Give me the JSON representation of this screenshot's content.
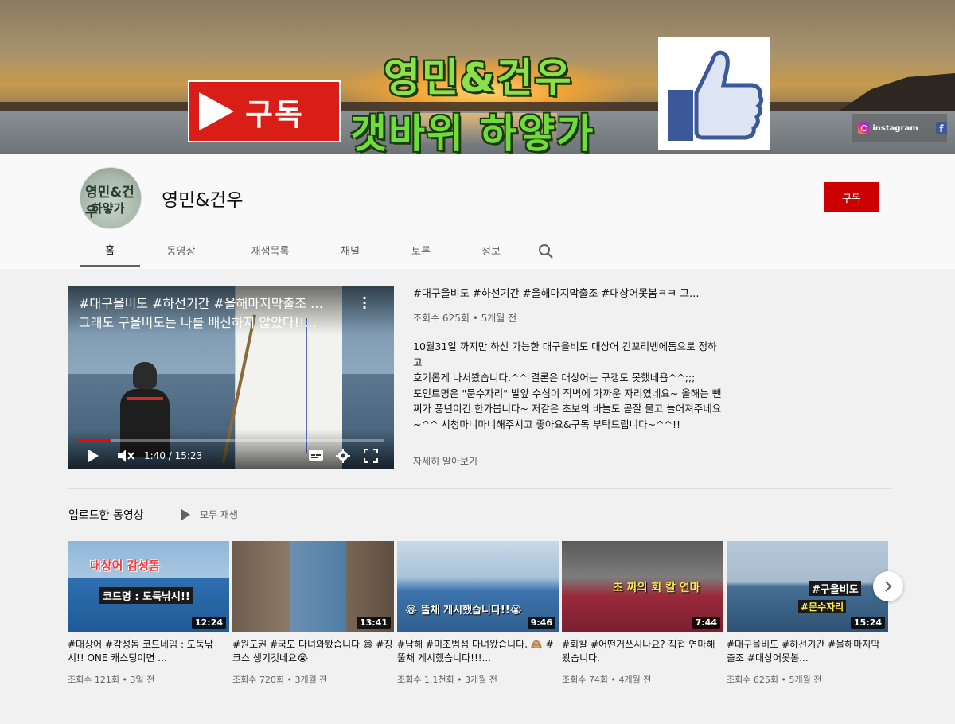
{
  "banner": {
    "subscribe_text": "구독",
    "title": "영민&건우",
    "subtitle": "갯바위 하얗가",
    "social": {
      "instagram_label": "instagram",
      "facebook_glyph": "f"
    }
  },
  "channel": {
    "name": "영민&건우",
    "avatar_text_1": "영민&건우",
    "avatar_text_2": "하얗가",
    "subscribe_label": "구독"
  },
  "tabs": [
    {
      "label": "홈",
      "active": true
    },
    {
      "label": "동영상"
    },
    {
      "label": "재생목록"
    },
    {
      "label": "채널"
    },
    {
      "label": "토론"
    },
    {
      "label": "정보"
    }
  ],
  "featured": {
    "player_title_line1": "#대구을비도 #하선기간 #올해마지막출조 …",
    "player_title_line2": "그래도 구을비도는 나를 배신하지 않았다!!...",
    "current_time": "1:40 / 15:23",
    "progress": 0.108,
    "title": "#대구을비도 #하선기간 #올해마지막출조 #대상어못봄ㅋㅋ 그...",
    "meta": "조회수 625회 • 5개월 전",
    "description": "10월31일 까지만 하선  가능한 대구을비도 대상어 긴꼬리벵에돔으로 정하고\n호기롭게 나서봤습니다.^^ 결론은 대상어는 구갱도 못했네욥^^;;;\n포인트명은 \"문수자리\" 발앞 수심이 직벽에 가까운 자리였네요~ 올해는 뺀찌가 풍년이긴 한가봅니다~ 저같은 초보의 바늘도 곧잘 물고 늘어져주네요~^^ 시청마니마니해주시고 좋아요&구독 부탁드립니다~^^!!",
    "more_label": "자세히 알아보기"
  },
  "uploads": {
    "section_title": "업로드한 동영상",
    "play_all_label": "모두 재생",
    "videos": [
      {
        "title": "#대상어 #감성돔 코드네임 : 도둑낚시!! ONE 캐스팅이면 ...",
        "meta": "조회수 121회 • 3일 전",
        "duration": "12:24",
        "thumb_text_1": "대상어 감성돔",
        "thumb_text_2": "코드명 : 도둑낚시!!"
      },
      {
        "title": "#원도권 #국도 다녀와봤습니다 😄 #징크스 생기것네요😭",
        "meta": "조회수 720회 • 3개월 전",
        "duration": "13:41",
        "thumb_text_1": "",
        "thumb_text_2": ""
      },
      {
        "title": "#남해 #미조범섬 다녀왔습니다. 🙈 #뚤채 게시했습니다!!!...",
        "meta": "조회수 1.1천회 • 3개월 전",
        "duration": "9:46",
        "thumb_text_1": "😂 뚤채 게시했습니다!!😭",
        "thumb_text_2": ""
      },
      {
        "title": "#회칼 #어떤거쓰시나요? 직접 연마해봤습니다.",
        "meta": "조회수 74회 • 4개월 전",
        "duration": "7:44",
        "thumb_text_1": "초 짜의 회 칼 연마",
        "thumb_text_2": ""
      },
      {
        "title": "#대구을비도 #하선기간 #올해마지막출조 #대상어못봄...",
        "meta": "조회수 625회 • 5개월 전",
        "duration": "15:24",
        "thumb_text_1": "#구을비도",
        "thumb_text_2": "#문수자리"
      }
    ]
  }
}
